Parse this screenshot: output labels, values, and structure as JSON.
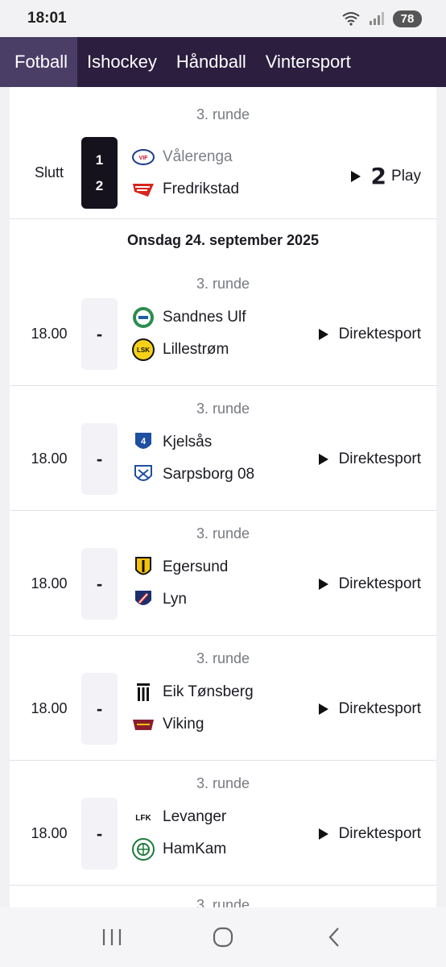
{
  "status": {
    "time": "18:01",
    "battery": "78"
  },
  "tabs": [
    {
      "label": "Fotball",
      "active": true
    },
    {
      "label": "Ishockey",
      "active": false
    },
    {
      "label": "Håndball",
      "active": false
    },
    {
      "label": "Vintersport",
      "active": false
    }
  ],
  "first_match": {
    "round": "3. runde",
    "status": "Slutt",
    "home": {
      "name": "Vålerenga",
      "score": "1"
    },
    "away": {
      "name": "Fredrikstad",
      "score": "2"
    },
    "channel": "Play",
    "channel_logo": "2"
  },
  "date_header": "Onsdag 24. september 2025",
  "matches": [
    {
      "round": "3. runde",
      "time": "18.00",
      "score": "-",
      "home": "Sandnes Ulf",
      "away": "Lillestrøm",
      "channel": "Direktesport"
    },
    {
      "round": "3. runde",
      "time": "18.00",
      "score": "-",
      "home": "Kjelsås",
      "away": "Sarpsborg 08",
      "channel": "Direktesport"
    },
    {
      "round": "3. runde",
      "time": "18.00",
      "score": "-",
      "home": "Egersund",
      "away": "Lyn",
      "channel": "Direktesport"
    },
    {
      "round": "3. runde",
      "time": "18.00",
      "score": "-",
      "home": "Eik Tønsberg",
      "away": "Viking",
      "channel": "Direktesport"
    },
    {
      "round": "3. runde",
      "time": "18.00",
      "score": "-",
      "home": "Levanger",
      "away": "HamKam",
      "channel": "Direktesport"
    }
  ],
  "partial_card": {
    "round": "3. runde"
  }
}
